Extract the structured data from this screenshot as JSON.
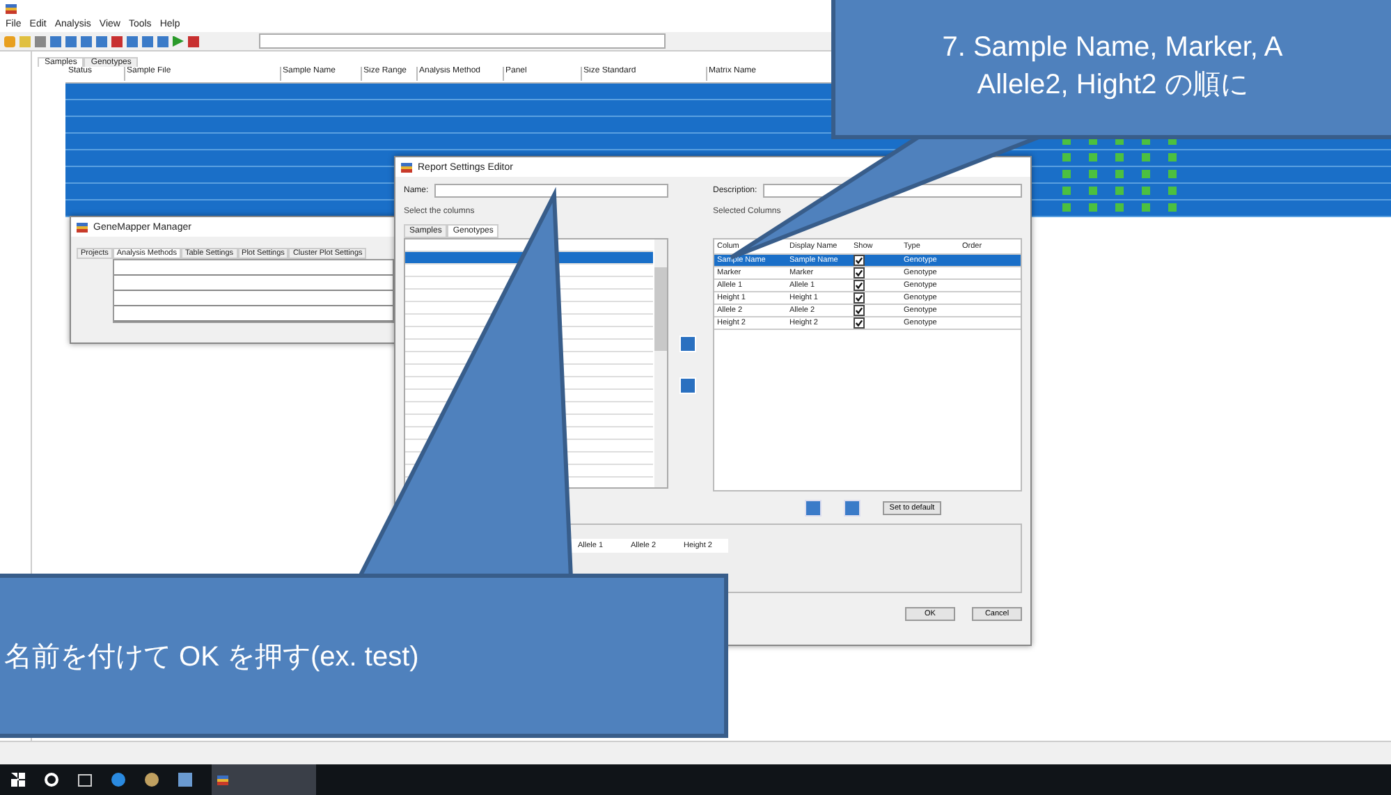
{
  "app": {
    "menu": [
      "File",
      "Edit",
      "Analysis",
      "View",
      "Tools",
      "Help"
    ],
    "tabs": [
      {
        "label": "Samples",
        "selected": true
      },
      {
        "label": "Genotypes",
        "selected": false
      }
    ],
    "table": {
      "columns": [
        "Status",
        "Sample File",
        "Sample Name",
        "Size Range",
        "Analysis Method",
        "Panel",
        "Size Standard",
        "Matrix Name"
      ],
      "rows": [
        {
          "selected": true
        },
        {
          "selected": true
        },
        {
          "selected": true
        },
        {
          "selected": true
        },
        {
          "selected": true
        },
        {
          "selected": true
        },
        {
          "selected": true
        },
        {
          "selected": true
        }
      ]
    }
  },
  "manager_window": {
    "title": "GeneMapper Manager",
    "tabs": [
      {
        "label": "Projects",
        "selected": false
      },
      {
        "label": "Analysis Methods",
        "selected": true
      },
      {
        "label": "Table Settings",
        "selected": false
      },
      {
        "label": "Plot Settings",
        "selected": false
      },
      {
        "label": "Cluster Plot Settings",
        "selected": false
      }
    ]
  },
  "dialog": {
    "title": "Report Settings Editor",
    "name_label": "Name:",
    "description_label": "Description:",
    "select_group": "Select the columns",
    "selected_group": "Selected Columns",
    "tabs": [
      {
        "label": "Samples",
        "selected": false
      },
      {
        "label": "Genotypes",
        "selected": true
      }
    ],
    "columns": [
      "Colum",
      "Display Name",
      "Show",
      "Type",
      "Order"
    ],
    "rows": [
      {
        "column": "Sample Name",
        "display": "Sample Name",
        "show": true,
        "type": "Genotype",
        "selected": true
      },
      {
        "column": "Marker",
        "display": "Marker",
        "show": true,
        "type": "Genotype",
        "selected": false
      },
      {
        "column": "Allele 1",
        "display": "Allele 1",
        "show": true,
        "type": "Genotype",
        "selected": false
      },
      {
        "column": "Height 1",
        "display": "Height 1",
        "show": true,
        "type": "Genotype",
        "selected": false
      },
      {
        "column": "Allele 2",
        "display": "Allele 2",
        "show": true,
        "type": "Genotype",
        "selected": false
      },
      {
        "column": "Height 2",
        "display": "Height 2",
        "show": true,
        "type": "Genotype",
        "selected": false
      }
    ],
    "default_button": "Set to default",
    "preview": [
      "Allele 1",
      "Allele 2",
      "Height 2"
    ],
    "ok": "OK",
    "cancel": "Cancel"
  },
  "callouts": [
    {
      "kind": "top",
      "lines": [
        "7. Sample Name, Marker, A",
        "Allele2, Hight2 の順に"
      ]
    },
    {
      "kind": "bottom",
      "lines": [
        "名前を付けて OK を押す(ex. test)"
      ]
    }
  ]
}
